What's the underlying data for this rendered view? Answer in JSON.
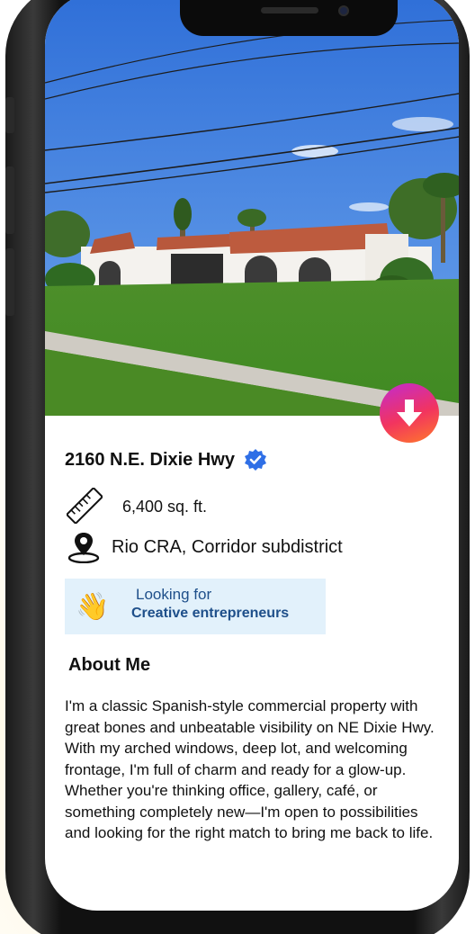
{
  "property": {
    "address": "2160 N.E. Dixie Hwy",
    "area": "6,400 sq. ft.",
    "location": "Rio CRA, Corridor subdistrict",
    "looking_label": "Looking for",
    "looking_value": "Creative entrepreneurs"
  },
  "about": {
    "heading": "About Me",
    "text": "I'm a classic Spanish-style commercial property with great bones and unbeatable visibility on NE Dixie Hwy. With my arched windows, deep lot, and welcoming frontage, I'm full of charm and ready for a glow-up. Whether you're thinking office, gallery, café, or something completely new—I'm open to possibilities and looking for the right match to bring me back to life."
  },
  "colors": {
    "accent": "#1e4f8a",
    "verified": "#2f6fe6",
    "card_bg": "#e2f1fb",
    "download_gradient": [
      "#c12bd0",
      "#f2345f",
      "#ff7a2a"
    ]
  },
  "icons": {
    "verified": "verified-badge-icon",
    "area": "ruler-icon",
    "location": "map-pin-icon",
    "looking": "waving-hand-icon",
    "download": "arrow-down-icon"
  }
}
